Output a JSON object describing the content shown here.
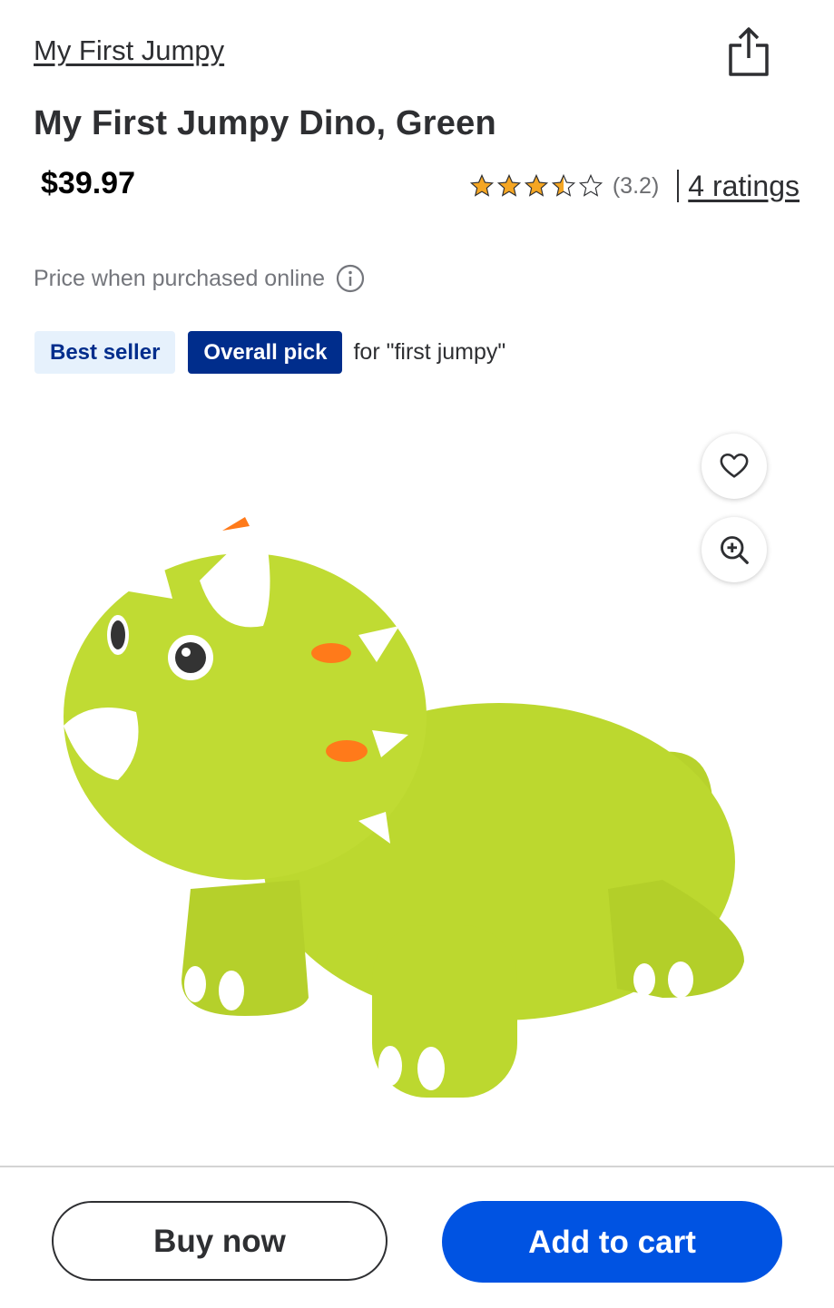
{
  "brand": {
    "label": "My First Jumpy"
  },
  "product": {
    "title": "My First Jumpy Dino, Green",
    "price": "$39.97",
    "rating_value": 3.5,
    "rating_text": "(3.2)",
    "ratings_count_text": "4 ratings",
    "price_note": "Price when purchased online"
  },
  "badges": {
    "best_seller": "Best seller",
    "overall_pick": "Overall pick",
    "for_query": "for \"first jumpy\""
  },
  "image": {
    "icon": "green-dino-toy",
    "body_color": "#bcd82f"
  },
  "actions": {
    "share_icon": "share-icon",
    "favorite_icon": "heart-icon",
    "zoom_icon": "zoom-in-icon",
    "buy_now": "Buy now",
    "add_to_cart": "Add to cart"
  },
  "colors": {
    "accent_blue": "#0053e2",
    "badge_navy": "#002d8c",
    "badge_light": "#e6f1fc",
    "star": "#f5a623"
  }
}
